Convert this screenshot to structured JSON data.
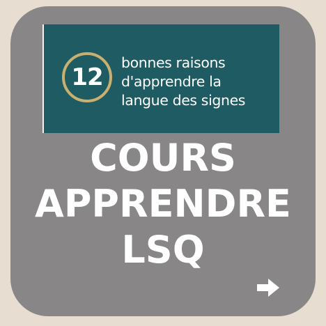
{
  "banner": {
    "number": "12",
    "lines": [
      "bonnes raisons",
      "d'apprendre la",
      "langue des signes"
    ]
  },
  "headline": {
    "lines": [
      "COURS",
      "APPRENDRE",
      "LSQ"
    ]
  },
  "arrow": {
    "icon": "arrow-right-icon"
  },
  "colors": {
    "page_background": "#e8ddd1",
    "tile_background": "#888687",
    "banner_background": "#1e5b62",
    "badge_ring": "#c9b071",
    "text": "#ffffff"
  }
}
